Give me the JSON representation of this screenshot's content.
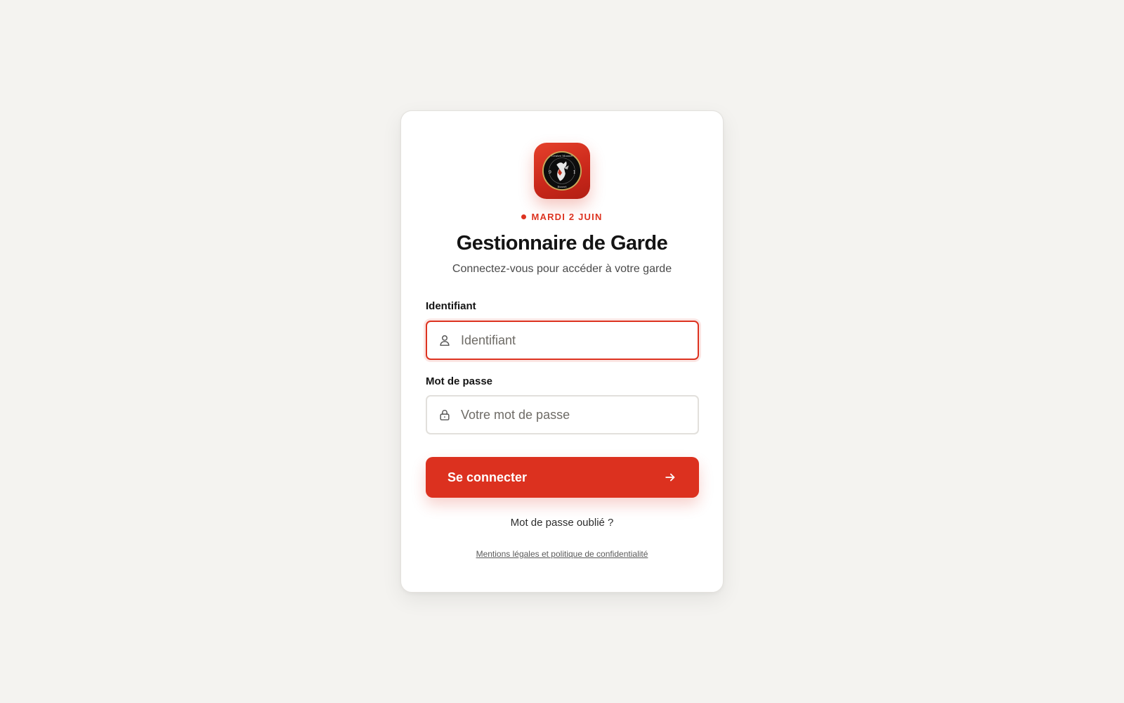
{
  "brand": {
    "logo_icon": "fire-brigade-emblem-icon",
    "logo_text_top": "Centre Mozart",
    "logo_text_bottom": "Essert",
    "logo_numbers": [
      "9",
      "1"
    ]
  },
  "header": {
    "date": "MARDI 2 JUIN",
    "title": "Gestionnaire de Garde",
    "subtitle": "Connectez-vous pour accéder à votre garde"
  },
  "form": {
    "username": {
      "label": "Identifiant",
      "placeholder": "Identifiant",
      "value": "",
      "icon": "user-icon",
      "focused": true
    },
    "password": {
      "label": "Mot de passe",
      "placeholder": "Votre mot de passe",
      "value": "",
      "icon": "lock-icon"
    },
    "submit_label": "Se connecter",
    "submit_icon": "arrow-right-icon"
  },
  "links": {
    "forgot_password": "Mot de passe oublié ?",
    "legal": "Mentions légales et politique de confidentialité"
  },
  "colors": {
    "accent": "#dc311f",
    "background": "#f4f3f0",
    "card": "#ffffff"
  }
}
